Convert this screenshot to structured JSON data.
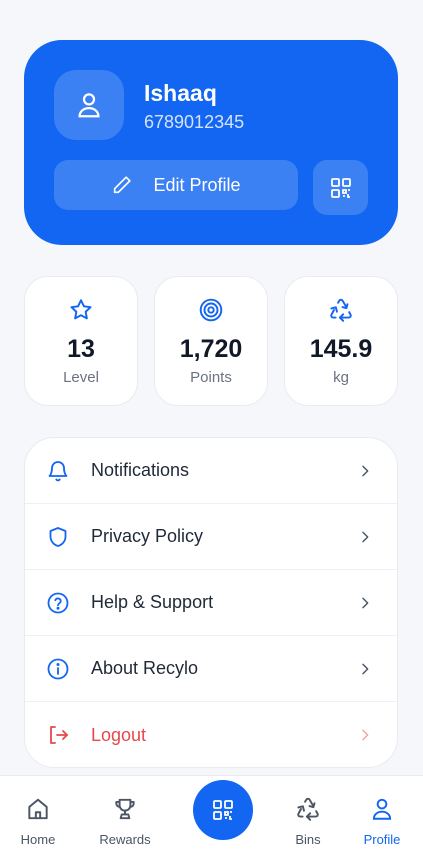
{
  "profile": {
    "name": "Ishaaq",
    "phone": "6789012345",
    "edit_label": "Edit Profile"
  },
  "stats": [
    {
      "value": "13",
      "label": "Level",
      "icon": "star-icon"
    },
    {
      "value": "1,720",
      "label": "Points",
      "icon": "target-icon"
    },
    {
      "value": "145.9",
      "label": "kg",
      "icon": "recycle-icon"
    }
  ],
  "menu": [
    {
      "label": "Notifications",
      "icon": "bell-icon"
    },
    {
      "label": "Privacy Policy",
      "icon": "shield-icon"
    },
    {
      "label": "Help & Support",
      "icon": "help-circle-icon"
    },
    {
      "label": "About Recylo",
      "icon": "info-icon"
    },
    {
      "label": "Logout",
      "icon": "logout-icon"
    }
  ],
  "nav": [
    {
      "label": "Home",
      "icon": "home-icon"
    },
    {
      "label": "Rewards",
      "icon": "trophy-icon"
    },
    {
      "label": "Bins",
      "icon": "recycle-icon"
    },
    {
      "label": "Profile",
      "icon": "user-icon",
      "active": true
    }
  ],
  "colors": {
    "primary": "#1266f1",
    "danger": "#e5484d",
    "background": "#f5f7fa"
  }
}
